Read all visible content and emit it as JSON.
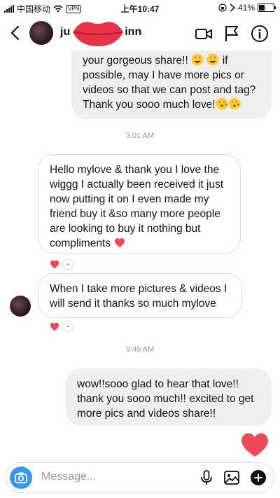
{
  "status_bar": {
    "carrier": "中国移动",
    "vpn": "VPN",
    "time": "上午10:47",
    "battery_text": "41%",
    "battery_level": 0.41
  },
  "header": {
    "name_prefix": "ju",
    "name_suffix": "inn",
    "icons": [
      "back-icon",
      "video-call-icon",
      "flag-icon",
      "info-icon"
    ]
  },
  "messages": {
    "m1_text": "your gorgeous share!! ",
    "m1_line2": "if possible, may I have more pics or videos so that we can post and tag? Thank you sooo much love!",
    "ts1": "3:01 AM",
    "m2_text": "Hello mylove & thank you I love the wiggg I actually been received it just now putting it on I even made my friend buy it &so many more people are looking to buy it nothing but compliments ",
    "m3_text": "When I take more pictures & videos I will send it thanks so much mylove",
    "ts2": "9:49 AM",
    "m4_text": "wow!!sooo glad to hear that love!! thank you sooo much!! excited to get more pics and videos share!!"
  },
  "composer": {
    "placeholder": "Message..."
  },
  "colors": {
    "accent": "#3897f0",
    "heart": "#ed4956",
    "bubble_out": "#efefef",
    "border": "#dbdbdb"
  }
}
